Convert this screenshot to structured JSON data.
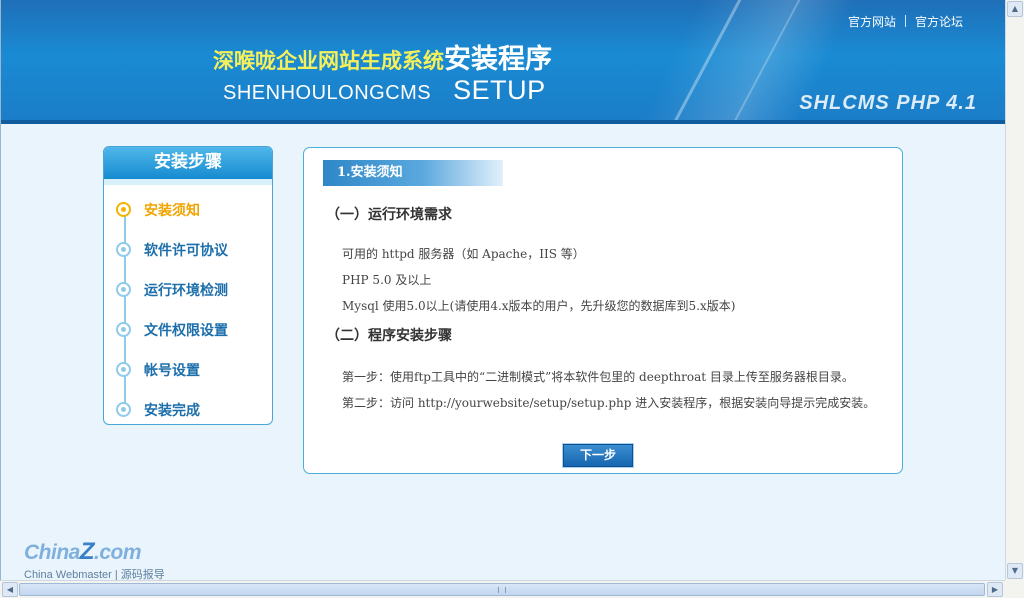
{
  "header": {
    "links": [
      "官方网站",
      "官方论坛"
    ],
    "title_cn_prefix": "深喉咙企业网站生成系统",
    "title_cn_main": "安装程序",
    "title_en": "SHENHOULONGCMS",
    "title_setup": "SETUP",
    "version": "SHLCMS PHP 4.1"
  },
  "sidebar": {
    "title": "安装步骤",
    "items": [
      {
        "label": "安装须知",
        "active": true
      },
      {
        "label": "软件许可协议",
        "active": false
      },
      {
        "label": "运行环境检测",
        "active": false
      },
      {
        "label": "文件权限设置",
        "active": false
      },
      {
        "label": "帐号设置",
        "active": false
      },
      {
        "label": "安装完成",
        "active": false
      }
    ]
  },
  "main": {
    "tab_title": "1.安装须知",
    "section1_title": "（一）运行环境需求",
    "section1_lines": [
      "可用的  httpd 服务器（如  Apache，IIS 等）",
      "PHP 5.0 及以上",
      "Mysql 使用5.0以上(请使用4.x版本的用户，先升级您的数据库到5.x版本)"
    ],
    "section2_title": "（二）程序安装步骤",
    "section2_lines": [
      "第一步：使用ftp工具中的“二进制模式”将本软件包里的  deepthroat 目录上传至服务器根目录。",
      "第二步：访问  http://yourwebsite/setup/setup.php 进入安装程序，根据安装向导提示完成安装。"
    ],
    "next_button": "下一步"
  },
  "watermark": {
    "line1_a": "China",
    "line1_z": "Z",
    "line1_b": ".com",
    "line2": "China Webmaster | 源码报导"
  },
  "colors": {
    "header": "#1a8bd3",
    "title_yellow": "#f6f05a",
    "active_step": "#f0a400",
    "step_text": "#1d6fab",
    "border": "#49aed8"
  }
}
